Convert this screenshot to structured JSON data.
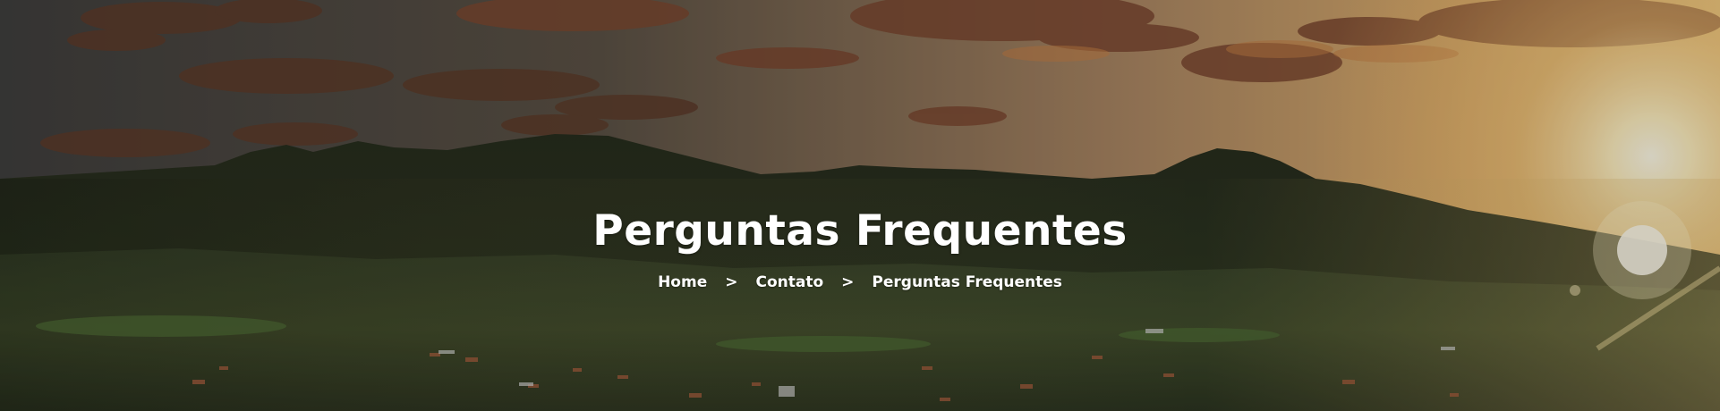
{
  "hero": {
    "title": "Perguntas Frequentes",
    "background": {
      "sky_top": "#4b4a47",
      "sky_glow": "#f3c86a",
      "sun": "#fff6d6",
      "mountain": "#2c3421",
      "valley": "#3e4a2b"
    }
  },
  "breadcrumb": {
    "separator": ">",
    "items": [
      {
        "label": "Home"
      },
      {
        "label": "Contato"
      },
      {
        "label": "Perguntas Frequentes"
      }
    ]
  }
}
